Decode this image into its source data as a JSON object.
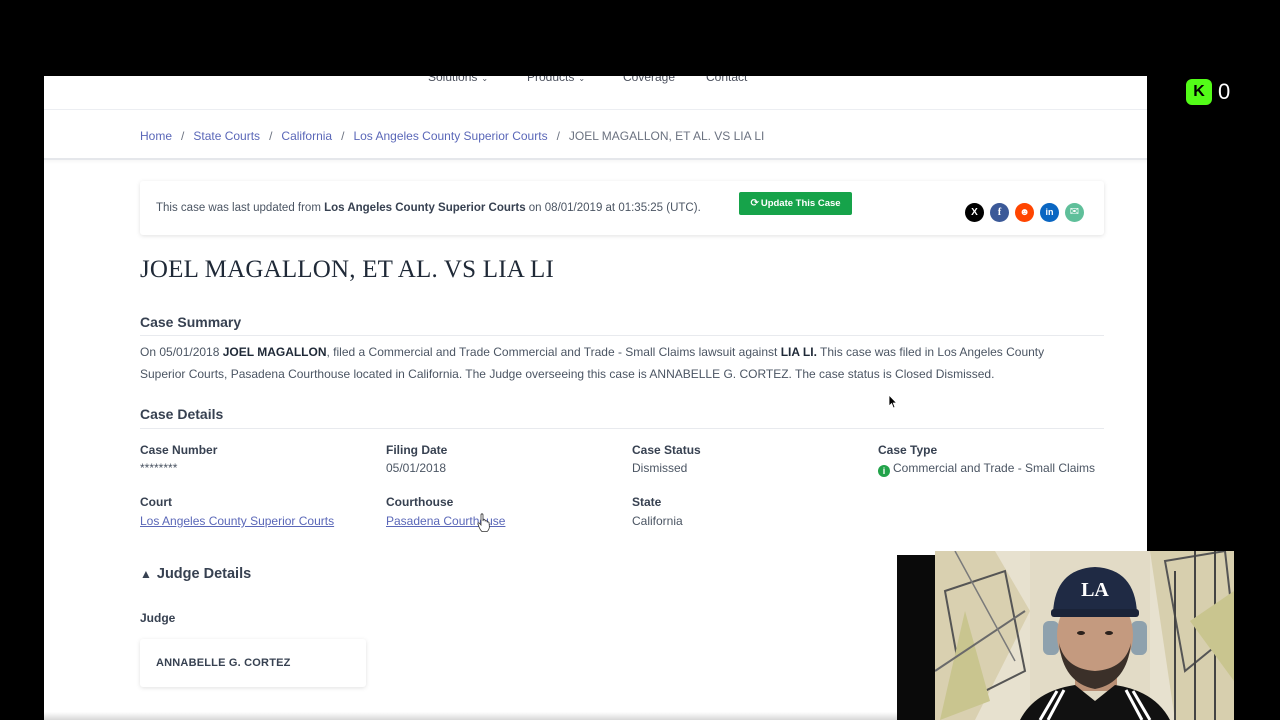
{
  "topnav": {
    "items": [
      {
        "label": "Solutions",
        "has_dropdown": true
      },
      {
        "label": "Products",
        "has_dropdown": true
      },
      {
        "label": "Coverage",
        "has_dropdown": false
      },
      {
        "label": "Contact",
        "has_dropdown": false
      }
    ]
  },
  "breadcrumbs": {
    "items": [
      "Home",
      "State Courts",
      "California",
      "Los Angeles County Superior Courts"
    ],
    "current": "JOEL MAGALLON, ET AL. VS LIA LI"
  },
  "update_notice": {
    "prefix": "This case was last updated from ",
    "source": "Los Angeles County Superior Courts",
    "middle": " on ",
    "datetime": "08/01/2019 at 01:35:25 (UTC).",
    "button_label": "Update This Case"
  },
  "share": {
    "icons": [
      "x-icon",
      "facebook-icon",
      "reddit-icon",
      "linkedin-icon",
      "email-icon"
    ],
    "colors": {
      "x": "#000000",
      "facebook": "#3b5998",
      "reddit": "#ff4500",
      "linkedin": "#0a66c2",
      "email": "#5fbf9a"
    }
  },
  "case_title": "JOEL MAGALLON, ET AL. VS LIA LI",
  "summary": {
    "heading": "Case Summary",
    "p1": "On 05/01/2018 ",
    "plaintiff": "JOEL MAGALLON",
    "p2": ", filed a Commercial and Trade Commercial and Trade - Small Claims lawsuit against ",
    "defendant": "LIA LI.",
    "p3": " This case was filed in Los Angeles County Superior Courts, Pasadena Courthouse located in California. The Judge overseeing this case is ANNABELLE G. CORTEZ. The case status is Closed Dismissed."
  },
  "details": {
    "heading": "Case Details",
    "case_number": {
      "label": "Case Number",
      "value": "********"
    },
    "filing_date": {
      "label": "Filing Date",
      "value": "05/01/2018"
    },
    "case_status": {
      "label": "Case Status",
      "value": "Dismissed"
    },
    "case_type": {
      "label": "Case Type",
      "value": "Commercial and Trade - Small Claims"
    },
    "court": {
      "label": "Court",
      "value": "Los Angeles County Superior Courts"
    },
    "courthouse": {
      "label": "Courthouse",
      "value": "Pasadena Courthouse"
    },
    "state": {
      "label": "State",
      "value": "California"
    }
  },
  "judge": {
    "heading": "Judge Details",
    "label": "Judge",
    "name": "ANNABELLE G. CORTEZ"
  },
  "overlay": {
    "kick_count": "0",
    "kick_color": "#53fc18",
    "webcam_caps_text": "LA"
  },
  "colors": {
    "link": "#5a67b8",
    "button_green": "#16a34a",
    "heading": "#374151"
  }
}
